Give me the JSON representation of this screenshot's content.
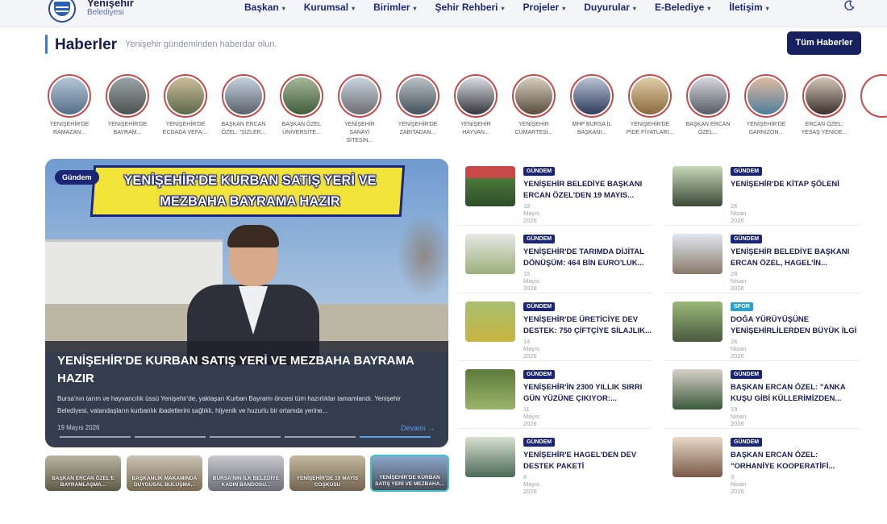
{
  "brand": {
    "name": "Yenişehir",
    "sub": "Belediyesi"
  },
  "nav": [
    {
      "label": "Başkan"
    },
    {
      "label": "Kurumsal"
    },
    {
      "label": "Birimler"
    },
    {
      "label": "Şehir Rehberi"
    },
    {
      "label": "Projeler"
    },
    {
      "label": "Duyurular"
    },
    {
      "label": "E-Belediye"
    },
    {
      "label": "İletişim"
    }
  ],
  "section": {
    "title": "Haberler",
    "subtitle": "Yenişehir gündeminden haberdar olun.",
    "all_button": "Tüm Haberler"
  },
  "stories": [
    {
      "l1": "YENİŞEHİR'DE",
      "l2": "RAMAZAN..."
    },
    {
      "l1": "YENİŞEHİR'DE",
      "l2": "BAYRAM..."
    },
    {
      "l1": "YENİŞEHİR'DE",
      "l2": "ECDADA VEFA:..."
    },
    {
      "l1": "BAŞKAN ERCAN",
      "l2": "ÖZEL: \"SİZLER..."
    },
    {
      "l1": "BAŞKAN ÖZEL",
      "l2": "ÜNİVERSİTE..."
    },
    {
      "l1": "YENİŞEHİR",
      "l2": "SANAYİ SİTESİN..."
    },
    {
      "l1": "YENİŞEHİR'DE",
      "l2": "ZABITADAN..."
    },
    {
      "l1": "YENİŞEHİR",
      "l2": "HAYVAN..."
    },
    {
      "l1": "YENİŞEHİR",
      "l2": "CUMARTESİ..."
    },
    {
      "l1": "MHP BURSA İL",
      "l2": "BAŞKANI..."
    },
    {
      "l1": "YENİŞEHİR'DE",
      "l2": "PİDE FİYATLARI..."
    },
    {
      "l1": "BAŞKAN ERCAN",
      "l2": "ÖZEL..."
    },
    {
      "l1": "YENİŞEHİR'DE",
      "l2": "GARNİZON..."
    },
    {
      "l1": "ERCAN ÖZEL:",
      "l2": "YESAŞ YENİDE..."
    }
  ],
  "hero": {
    "badge": "Gündem",
    "banner_l1": "YENİŞEHİR'DE KURBAN SATIŞ YERİ VE",
    "banner_l2": "MEZBAHA BAYRAMA HAZIR",
    "title": "YENİŞEHİR'DE KURBAN SATIŞ YERİ VE MEZBAHA BAYRAMA HAZIR",
    "desc": "Bursa'nın tarım ve hayvancılık üssü Yenişehir'de, yaklaşan Kurban Bayramı öncesi tüm hazırlıklar tamamlandı. Yenişehir Belediyesi, vatandaşların kurbanlık ibadetlerini sağlıklı, hijyenik ve huzurlu bir ortamda yerine...",
    "date": "19 Mayıs 2026",
    "more": "Devamı →"
  },
  "thumbs": [
    {
      "label": "BAŞKAN ERCAN ÖZEL'E BAYRAMLAŞMA..."
    },
    {
      "label": "BAŞKANLIK MAKAMINDA DUYGUSAL BULUŞMA..."
    },
    {
      "label": "BURSA'NIN İLK BELEDİYE KADIN BANDOSU..."
    },
    {
      "label": "YENİŞEHİR'DE 19 MAYIS COŞKUSU"
    },
    {
      "label": "YENİŞEHİR'DE KURBAN SATIŞ YERİ VE MEZBAHA..."
    }
  ],
  "news_left": [
    {
      "tag": "GÜNDEM",
      "title": "YENİŞEHİR BELEDİYE BAŞKANI ERCAN ÖZEL'DEN 19 MAYIS...",
      "date": "18 Mayıs 2026"
    },
    {
      "tag": "GÜNDEM",
      "title": "YENİŞEHİR'DE TARIMDA DİJİTAL DÖNÜŞÜM: 464 BİN EURO'LUK...",
      "date": "15 Mayıs 2026"
    },
    {
      "tag": "GÜNDEM",
      "title": "YENİŞEHİR'DE ÜRETİCİYE DEV DESTEK: 750 ÇİFTÇİYE SİLAJLIK...",
      "date": "14 Mayıs 2026"
    },
    {
      "tag": "GÜNDEM",
      "title": "YENİŞEHİR'İN 2300 YILLIK SIRRI GÜN YÜZÜNE ÇIKIYOR:...",
      "date": "11 Mayıs 2026"
    },
    {
      "tag": "GÜNDEM",
      "title": "YENİŞEHİR'E HAGEL'DEN DEV DESTEK PAKETİ",
      "date": "8 Mayıs 2026"
    }
  ],
  "news_right": [
    {
      "tag": "GÜNDEM",
      "title": "YENİŞEHİR'DE KİTAP ŞÖLENİ",
      "date": "28 Nisan 2026"
    },
    {
      "tag": "GÜNDEM",
      "title": "YENİŞEHİR BELEDİYE BAŞKANI ERCAN ÖZEL, HAGEL'İN...",
      "date": "28 Nisan 2026"
    },
    {
      "tag": "SPOR",
      "title": "DOĞA YÜRÜYÜŞÜNE YENİŞEHİRLİLERDEN BÜYÜK İLGİ",
      "date": "28 Nisan 2026"
    },
    {
      "tag": "GÜNDEM",
      "title": "BAŞKAN ERCAN ÖZEL: \"ANKA KUŞU GİBİ KÜLLERİMİZDEN...",
      "date": "19 Nisan 2026"
    },
    {
      "tag": "GÜNDEM",
      "title": "BAŞKAN ERCAN ÖZEL: \"ORHANİYE KOOPERATİFİ...",
      "date": "3 Nisan 2026"
    }
  ],
  "colors": {
    "primary": "#17215e",
    "accent": "#3a7bd5",
    "ring": "#c94848",
    "spor": "#2ea0cc"
  }
}
